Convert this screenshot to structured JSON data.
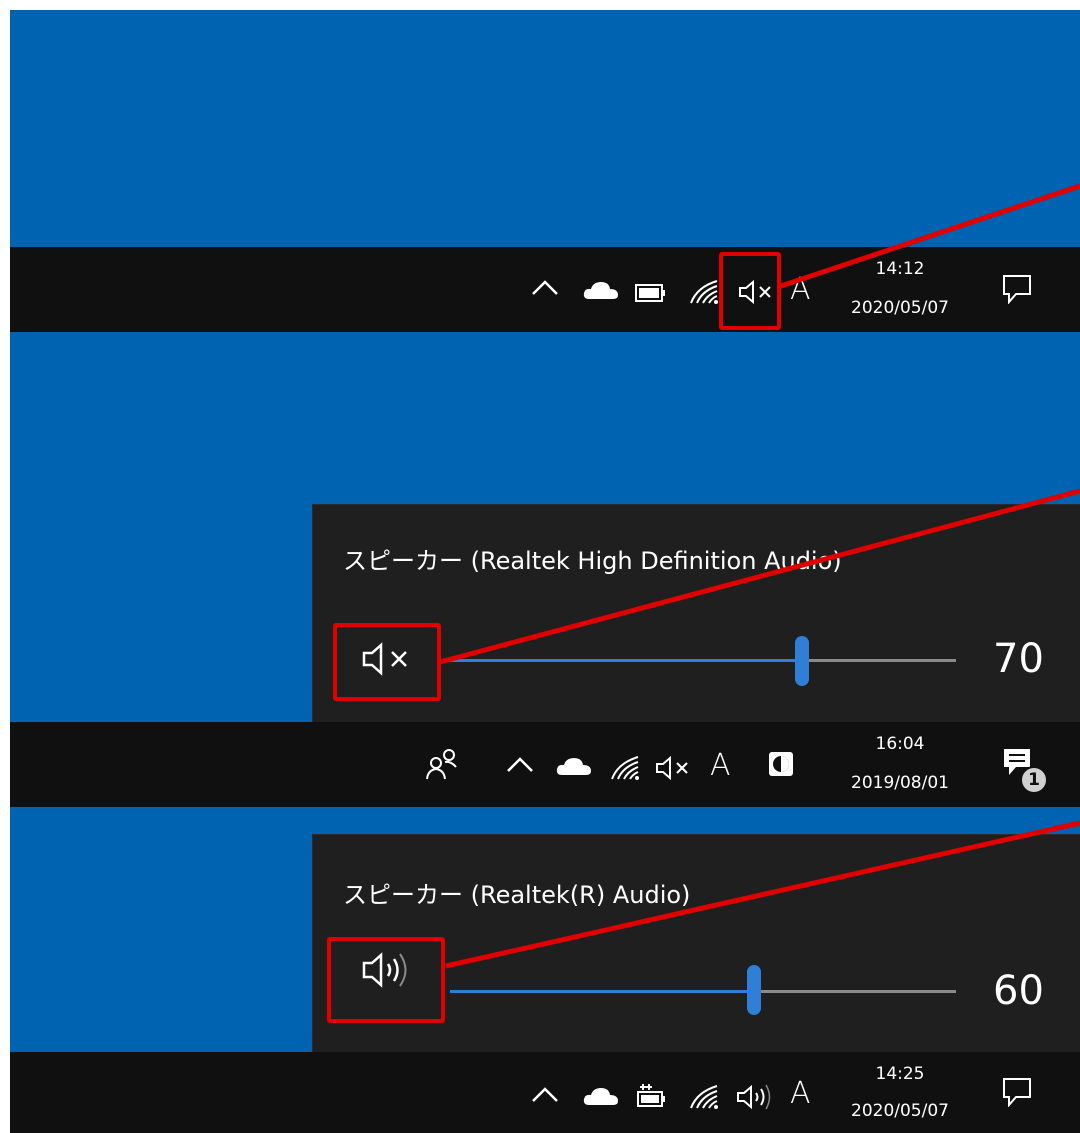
{
  "screen1": {
    "taskbar": {
      "time": "14:12",
      "date": "2020/05/07",
      "ime": "A",
      "volume_state": "muted"
    }
  },
  "screen2": {
    "panel": {
      "title": "スピーカー (Realtek High Definition Audio)",
      "volume": "70",
      "volume_state": "muted"
    },
    "taskbar": {
      "time": "16:04",
      "date": "2019/08/01",
      "ime": "A",
      "notification_count": "1",
      "volume_state": "muted"
    }
  },
  "screen3": {
    "panel": {
      "title": "スピーカー (Realtek(R) Audio)",
      "volume": "60",
      "volume_state": "on"
    },
    "taskbar": {
      "time": "14:25",
      "date": "2020/05/07",
      "ime": "A",
      "volume_state": "on"
    }
  },
  "colors": {
    "desktop": "#0063b1",
    "taskbar": "#101010",
    "panel": "#1f1f1f",
    "accent": "#2f7fd6",
    "highlight": "#e00000"
  }
}
